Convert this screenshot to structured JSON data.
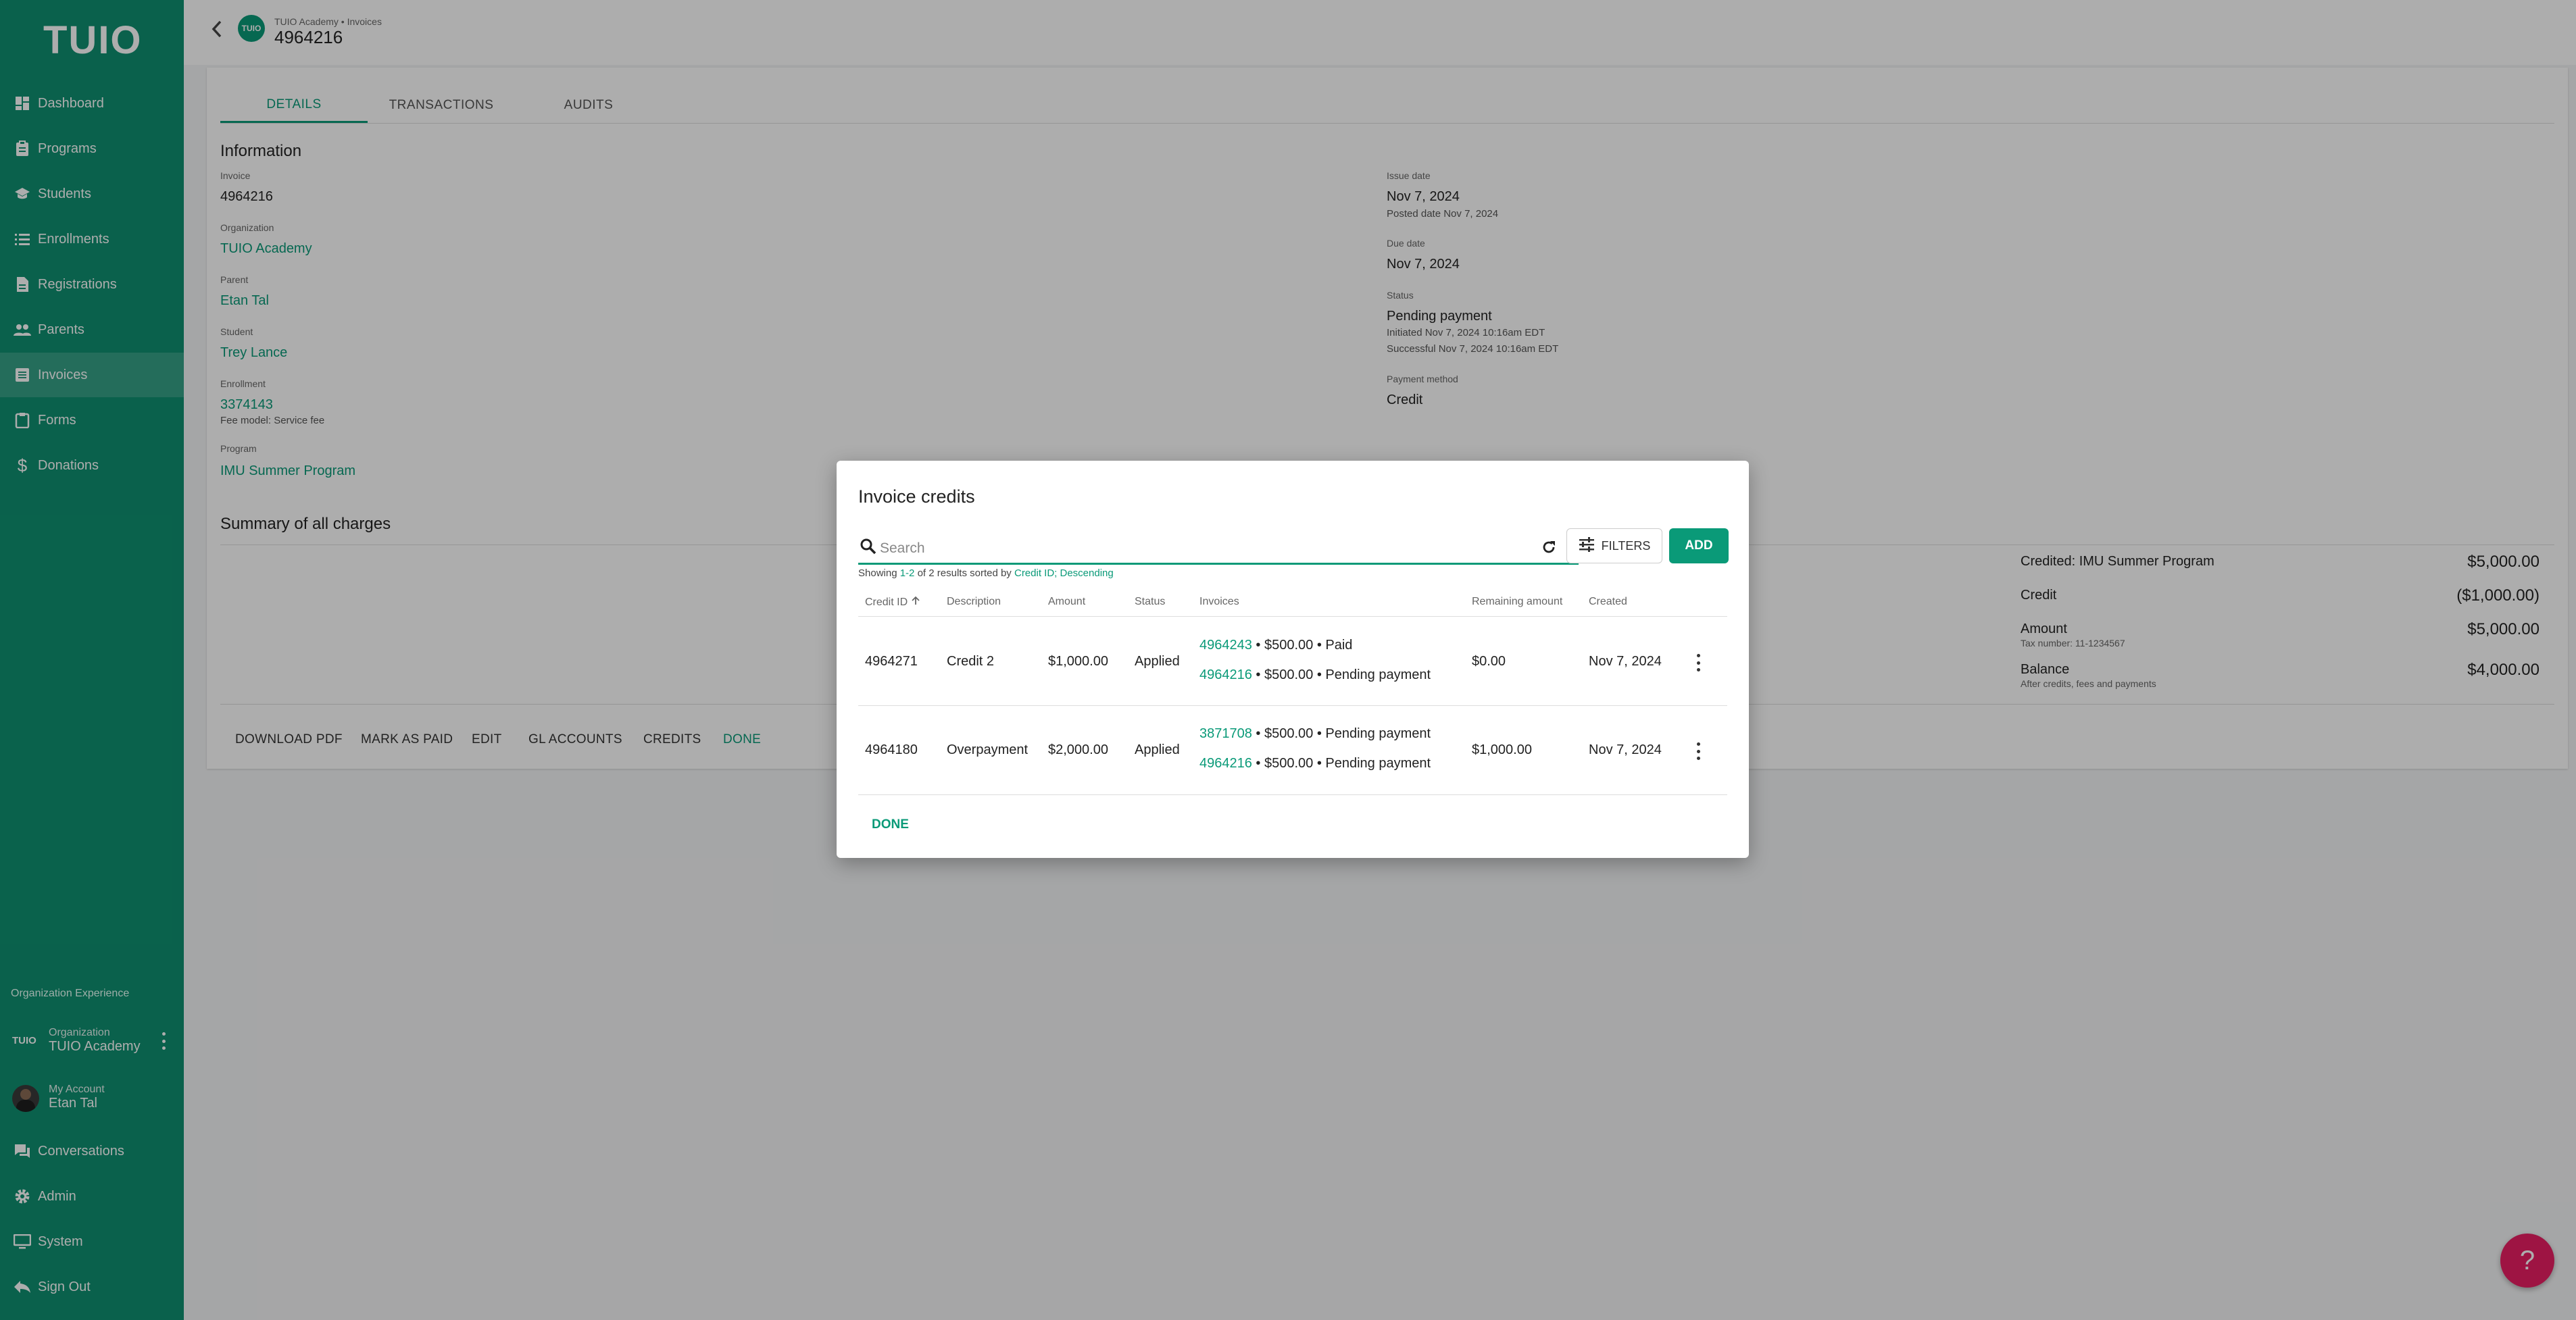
{
  "sidebar": {
    "logo": "TUIO",
    "items": [
      {
        "label": "Dashboard",
        "icon": "dashboard-icon"
      },
      {
        "label": "Programs",
        "icon": "clipboard-icon"
      },
      {
        "label": "Students",
        "icon": "graduation-cap-icon"
      },
      {
        "label": "Enrollments",
        "icon": "list-icon"
      },
      {
        "label": "Registrations",
        "icon": "document-icon"
      },
      {
        "label": "Parents",
        "icon": "people-icon"
      },
      {
        "label": "Invoices",
        "icon": "invoice-icon",
        "active": true
      },
      {
        "label": "Forms",
        "icon": "form-icon"
      },
      {
        "label": "Donations",
        "icon": "dollar-icon"
      }
    ],
    "org_section_title": "Organization Experience",
    "org_logo_text": "TUIO",
    "org_label": "Organization",
    "org_name": "TUIO Academy",
    "account_label": "My Account",
    "account_name": "Etan Tal",
    "bottom_items": [
      {
        "label": "Conversations",
        "icon": "chat-icon"
      },
      {
        "label": "Admin",
        "icon": "gear-icon"
      },
      {
        "label": "System",
        "icon": "monitor-icon"
      },
      {
        "label": "Sign Out",
        "icon": "sign-out-icon"
      }
    ]
  },
  "header": {
    "badge": "TUIO",
    "breadcrumb": "TUIO Academy • Invoices",
    "title": "4964216"
  },
  "tabs": [
    "DETAILS",
    "TRANSACTIONS",
    "AUDITS"
  ],
  "information": {
    "title": "Information",
    "invoice_label": "Invoice",
    "invoice": "4964216",
    "organization_label": "Organization",
    "organization": "TUIO Academy",
    "parent_label": "Parent",
    "parent": "Etan Tal",
    "student_label": "Student",
    "student": "Trey Lance",
    "enrollment_label": "Enrollment",
    "enrollment": "3374143",
    "fee_model": "Fee model: Service fee",
    "program_label": "Program",
    "program": "IMU Summer Program",
    "issue_date_label": "Issue date",
    "issue_date": "Nov 7, 2024",
    "posted_date": "Posted date Nov 7, 2024",
    "due_date_label": "Due date",
    "due_date": "Nov 7, 2024",
    "status_label": "Status",
    "status": "Pending payment",
    "initiated": "Initiated Nov 7, 2024 10:16am EDT",
    "successful": "Successful Nov 7, 2024 10:16am EDT",
    "payment_method_label": "Payment method",
    "payment_method": "Credit"
  },
  "summary": {
    "title": "Summary of all charges",
    "rows": [
      {
        "label": "Credited: IMU Summer Program",
        "value": "$5,000.00"
      },
      {
        "label": "Credit",
        "value": "($1,000.00)"
      },
      {
        "label": "Amount",
        "sub": "Tax number: 11-1234567",
        "value": "$5,000.00"
      },
      {
        "label": "Balance",
        "sub": "After credits, fees and payments",
        "value": "$4,000.00"
      }
    ]
  },
  "actions": [
    "DOWNLOAD PDF",
    "MARK AS PAID",
    "EDIT",
    "GL ACCOUNTS",
    "CREDITS",
    "DONE"
  ],
  "dialog": {
    "title": "Invoice credits",
    "search_placeholder": "Search",
    "filters_label": "FILTERS",
    "add_label": "ADD",
    "showing_prefix": "Showing ",
    "showing_range": "1-2",
    "showing_mid": " of 2 results sorted by ",
    "showing_sort": "Credit ID; Descending",
    "columns": [
      "Credit ID",
      "Description",
      "Amount",
      "Status",
      "Invoices",
      "Remaining amount",
      "Created"
    ],
    "rows": [
      {
        "credit_id": "4964271",
        "description": "Credit 2",
        "amount": "$1,000.00",
        "status": "Applied",
        "invoices": [
          {
            "id": "4964243",
            "detail": " • $500.00 • Paid"
          },
          {
            "id": "4964216",
            "detail": " • $500.00 • Pending payment"
          }
        ],
        "remaining": "$0.00",
        "created": "Nov 7, 2024"
      },
      {
        "credit_id": "4964180",
        "description": "Overpayment",
        "amount": "$2,000.00",
        "status": "Applied",
        "invoices": [
          {
            "id": "3871708",
            "detail": " • $500.00 • Pending payment"
          },
          {
            "id": "4964216",
            "detail": " • $500.00 • Pending payment"
          }
        ],
        "remaining": "$1,000.00",
        "created": "Nov 7, 2024"
      }
    ],
    "done_label": "DONE"
  },
  "help": "?"
}
